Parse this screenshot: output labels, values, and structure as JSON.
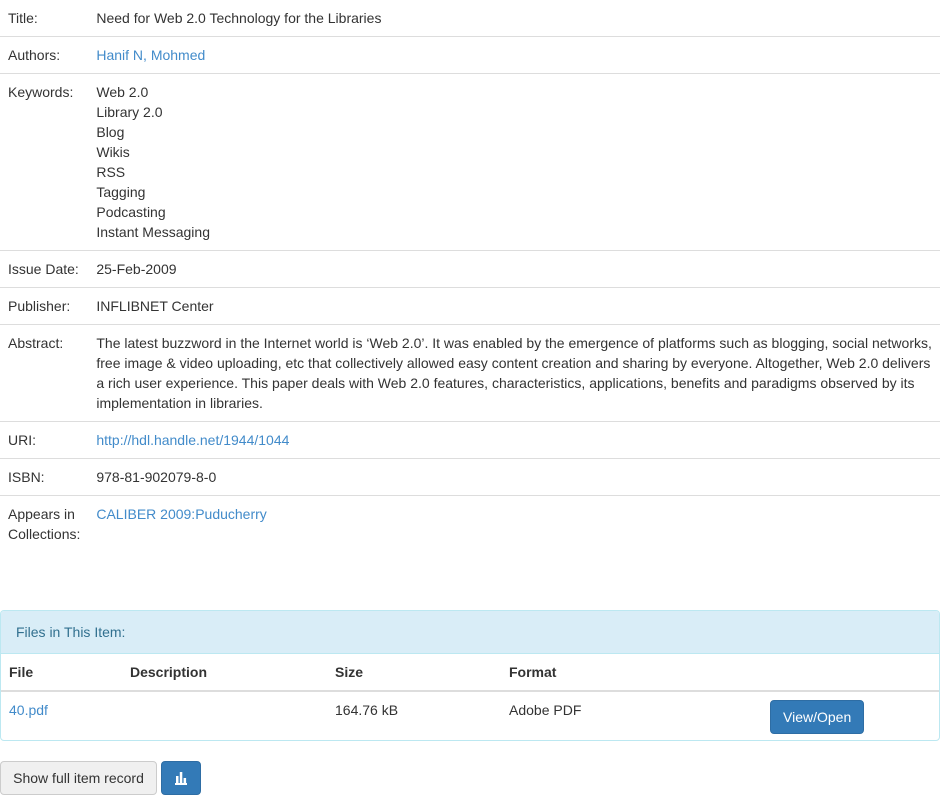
{
  "metadata": {
    "title_label": "Title:",
    "title": "Need for Web 2.0 Technology for the Libraries",
    "authors_label": "Authors:",
    "authors": "Hanif N, Mohmed",
    "keywords_label": "Keywords:",
    "keywords": [
      "Web 2.0",
      "Library 2.0",
      "Blog",
      "Wikis",
      "RSS",
      "Tagging",
      "Podcasting",
      "Instant Messaging"
    ],
    "issue_date_label": "Issue Date:",
    "issue_date": "25-Feb-2009",
    "publisher_label": "Publisher:",
    "publisher": "INFLIBNET Center",
    "abstract_label": "Abstract:",
    "abstract": "The latest buzzword in the Internet world is ‘Web 2.0’. It was enabled by the emergence of platforms such as blogging, social networks, free image & video uploading, etc that collectively allowed easy content creation and sharing by everyone. Altogether, Web 2.0 delivers a rich user experience. This paper deals with Web 2.0 features, characteristics, applications, benefits and paradigms observed by its implementation in libraries.",
    "uri_label": "URI:",
    "uri": "http://hdl.handle.net/1944/1044",
    "isbn_label": "ISBN:",
    "isbn": "978-81-902079-8-0",
    "collections_label": "Appears in Collections:",
    "collections": "CALIBER 2009:Puducherry"
  },
  "files": {
    "heading": "Files in This Item:",
    "columns": [
      "File",
      "Description",
      "Size",
      "Format"
    ],
    "rows": [
      {
        "file": "40.pdf",
        "description": "",
        "size": "164.76 kB",
        "format": "Adobe PDF",
        "action": "View/Open"
      }
    ]
  },
  "actions": {
    "show_full_record": "Show full item record",
    "stats_icon": "bar-chart-icon"
  },
  "colors": {
    "link": "#428bca",
    "primary": "#337ab7",
    "panel_heading_bg": "#d9edf7",
    "panel_heading_text": "#31708f"
  }
}
